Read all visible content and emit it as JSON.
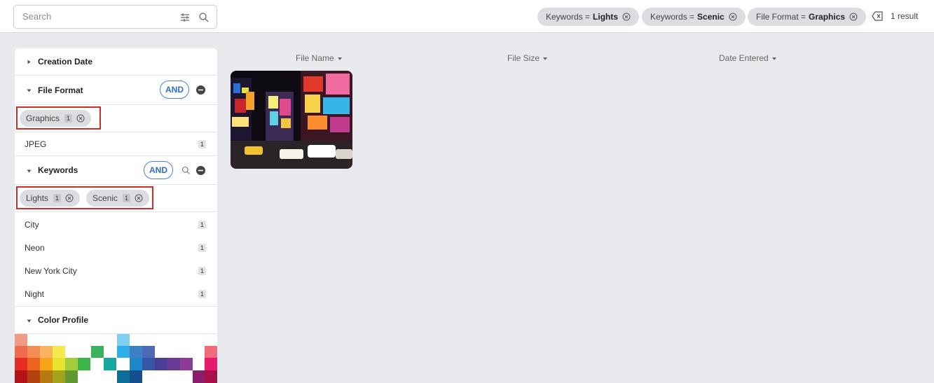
{
  "search": {
    "placeholder": "Search",
    "value": "",
    "filter_icon": "sliders-icon",
    "search_icon": "search-icon"
  },
  "active_filters": [
    {
      "prefix": "Keywords =",
      "value": "Lights"
    },
    {
      "prefix": "Keywords =",
      "value": "Scenic"
    },
    {
      "prefix": "File Format =",
      "value": "Graphics"
    }
  ],
  "result_count": "1 result",
  "sidebar": {
    "creation_date": {
      "title": "Creation Date"
    },
    "file_format": {
      "title": "File Format",
      "operator": "AND",
      "selected": [
        {
          "label": "Graphics",
          "count": "1"
        }
      ],
      "items": [
        {
          "label": "JPEG",
          "count": "1"
        }
      ]
    },
    "keywords": {
      "title": "Keywords",
      "operator": "AND",
      "selected": [
        {
          "label": "Lights",
          "count": "1"
        },
        {
          "label": "Scenic",
          "count": "1"
        }
      ],
      "items": [
        {
          "label": "City",
          "count": "1"
        },
        {
          "label": "Neon",
          "count": "1"
        },
        {
          "label": "New York City",
          "count": "1"
        },
        {
          "label": "Night",
          "count": "1"
        }
      ]
    },
    "color_profile": {
      "title": "Color Profile"
    }
  },
  "columns": {
    "file_name": "File Name",
    "file_size": "File Size",
    "date_entered": "Date Entered"
  },
  "colors": {
    "accent": "#2f6bd1",
    "highlight": "#d42b2b",
    "chip_bg": "#dcdde1",
    "canvas": "#e9eaee"
  }
}
